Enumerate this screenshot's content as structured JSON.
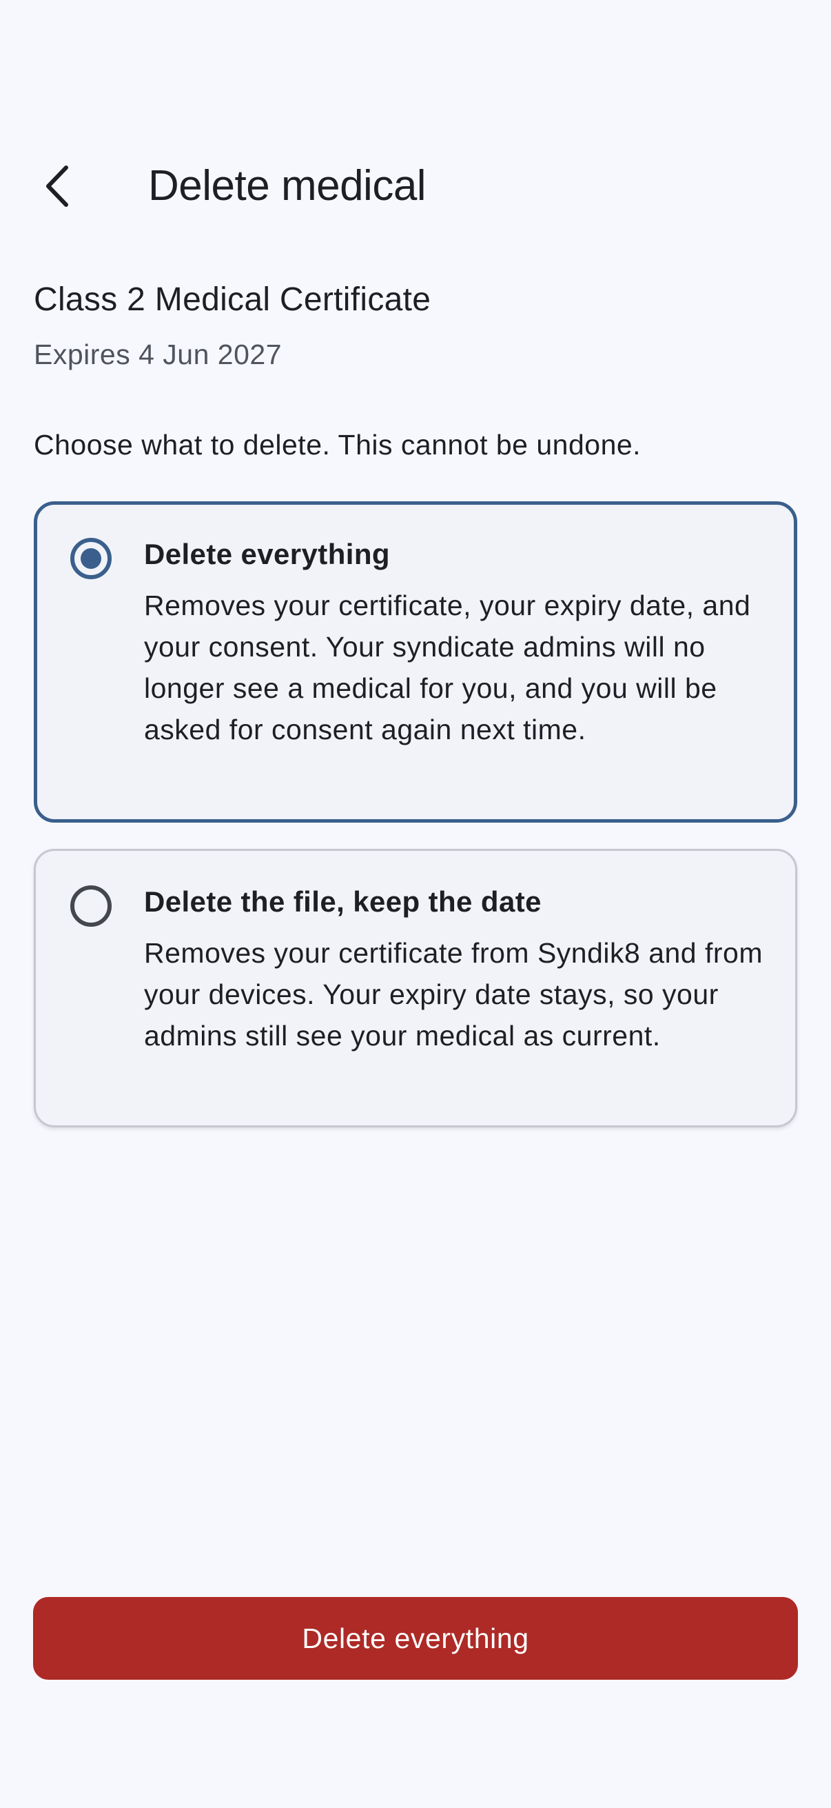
{
  "header": {
    "title": "Delete medical",
    "back_icon": "chevron-left-icon"
  },
  "certificate": {
    "name": "Class 2 Medical Certificate",
    "expiry": "Expires 4 Jun 2027"
  },
  "instruction": "Choose what to delete. This cannot be undone.",
  "options": [
    {
      "title": "Delete everything",
      "description": "Removes your certificate, your expiry date, and your consent. Your syndicate admins will no longer see a medical for you, and you will be asked for consent again next time.",
      "selected": true
    },
    {
      "title": "Delete the file, keep the date",
      "description": "Removes your certificate from Syndik8 and from your devices. Your expiry date stays, so your admins still see your medical as current.",
      "selected": false
    }
  ],
  "action": {
    "label": "Delete everything"
  },
  "colors": {
    "background": "#f7f8fd",
    "accent": "#3a5f8c",
    "danger": "#ad2a26",
    "card": "#f1f3f9"
  }
}
